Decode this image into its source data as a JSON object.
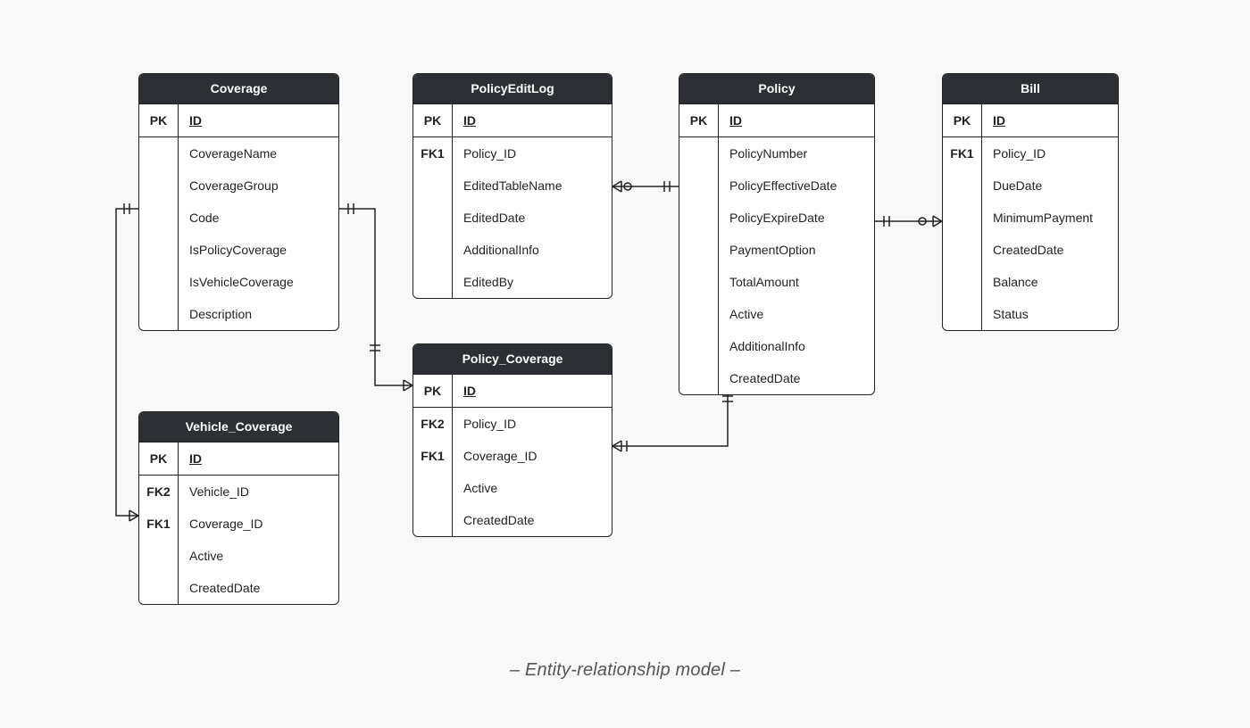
{
  "caption": "– Entity-relationship model –",
  "entities": {
    "coverage": {
      "title": "Coverage",
      "rows": [
        {
          "key": "PK",
          "attr": "ID",
          "pk": true,
          "sep": true
        },
        {
          "key": "",
          "attr": "CoverageName"
        },
        {
          "key": "",
          "attr": "CoverageGroup"
        },
        {
          "key": "",
          "attr": "Code"
        },
        {
          "key": "",
          "attr": "IsPolicyCoverage"
        },
        {
          "key": "",
          "attr": "IsVehicleCoverage"
        },
        {
          "key": "",
          "attr": "Description"
        }
      ]
    },
    "policyEditLog": {
      "title": "PolicyEditLog",
      "rows": [
        {
          "key": "PK",
          "attr": "ID",
          "pk": true,
          "sep": true
        },
        {
          "key": "FK1",
          "attr": "Policy_ID"
        },
        {
          "key": "",
          "attr": "EditedTableName"
        },
        {
          "key": "",
          "attr": "EditedDate"
        },
        {
          "key": "",
          "attr": "AdditionalInfo"
        },
        {
          "key": "",
          "attr": "EditedBy"
        }
      ]
    },
    "policy": {
      "title": "Policy",
      "rows": [
        {
          "key": "PK",
          "attr": "ID",
          "pk": true,
          "sep": true
        },
        {
          "key": "",
          "attr": "PolicyNumber"
        },
        {
          "key": "",
          "attr": "PolicyEffectiveDate"
        },
        {
          "key": "",
          "attr": "PolicyExpireDate"
        },
        {
          "key": "",
          "attr": "PaymentOption"
        },
        {
          "key": "",
          "attr": "TotalAmount"
        },
        {
          "key": "",
          "attr": "Active"
        },
        {
          "key": "",
          "attr": "AdditionalInfo"
        },
        {
          "key": "",
          "attr": "CreatedDate"
        }
      ]
    },
    "bill": {
      "title": "Bill",
      "rows": [
        {
          "key": "PK",
          "attr": "ID",
          "pk": true,
          "sep": true
        },
        {
          "key": "FK1",
          "attr": "Policy_ID"
        },
        {
          "key": "",
          "attr": "DueDate"
        },
        {
          "key": "",
          "attr": "MinimumPayment"
        },
        {
          "key": "",
          "attr": "CreatedDate"
        },
        {
          "key": "",
          "attr": "Balance"
        },
        {
          "key": "",
          "attr": "Status"
        }
      ]
    },
    "policyCoverage": {
      "title": "Policy_Coverage",
      "rows": [
        {
          "key": "PK",
          "attr": "ID",
          "pk": true,
          "sep": true
        },
        {
          "key": "FK2",
          "attr": "Policy_ID"
        },
        {
          "key": "FK1",
          "attr": "Coverage_ID"
        },
        {
          "key": "",
          "attr": "Active"
        },
        {
          "key": "",
          "attr": "CreatedDate"
        }
      ]
    },
    "vehicleCoverage": {
      "title": "Vehicle_Coverage",
      "rows": [
        {
          "key": "PK",
          "attr": "ID",
          "pk": true,
          "sep": true
        },
        {
          "key": "FK2",
          "attr": "Vehicle_ID"
        },
        {
          "key": "FK1",
          "attr": "Coverage_ID"
        },
        {
          "key": "",
          "attr": "Active"
        },
        {
          "key": "",
          "attr": "CreatedDate"
        }
      ]
    }
  },
  "relationships": [
    {
      "from": "PolicyEditLog.Policy_ID",
      "to": "Policy.ID",
      "cardinality": "many-to-one"
    },
    {
      "from": "Bill.Policy_ID",
      "to": "Policy.ID",
      "cardinality": "many-to-one"
    },
    {
      "from": "Policy_Coverage.Policy_ID",
      "to": "Policy.ID",
      "cardinality": "many-to-one"
    },
    {
      "from": "Policy_Coverage.Coverage_ID",
      "to": "Coverage.ID",
      "cardinality": "many-to-one"
    },
    {
      "from": "Vehicle_Coverage.Coverage_ID",
      "to": "Coverage.ID",
      "cardinality": "many-to-one"
    }
  ]
}
